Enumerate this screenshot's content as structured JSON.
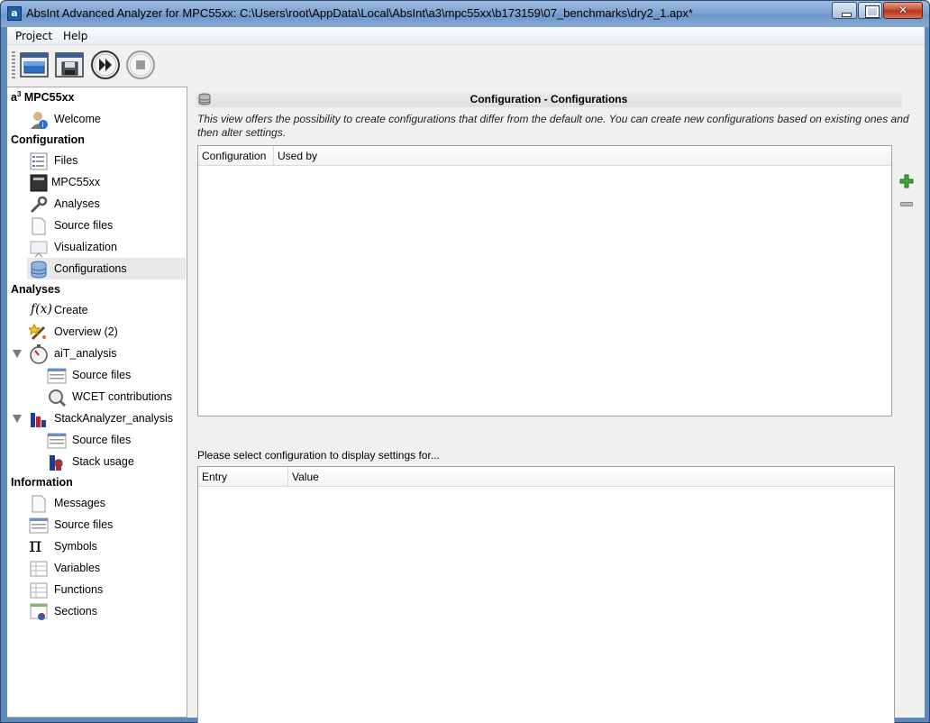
{
  "window": {
    "title": "AbsInt Advanced Analyzer for MPC55xx: C:\\Users\\root\\AppData\\Local\\AbsInt\\a3\\mpc55xx\\b173159\\07_benchmarks\\dry2_1.apx*",
    "app_icon": "a"
  },
  "menu": {
    "project": "Project",
    "help": "Help"
  },
  "toolbar": {
    "icons": [
      "open-project-icon",
      "save-project-icon",
      "run-icon",
      "stop-icon"
    ]
  },
  "sidebar": {
    "root_prefix": "a",
    "root_sup": "3",
    "root_label": "MPC55xx",
    "welcome": "Welcome",
    "configuration_header": "Configuration",
    "files": "Files",
    "mpc55xx": "MPC55xx",
    "analyses": "Analyses",
    "source_files": "Source files",
    "visualization": "Visualization",
    "configurations": "Configurations",
    "analyses_header": "Analyses",
    "create_fx": "f(x)",
    "create": "Create",
    "overview": "Overview (2)",
    "ait_analysis": "aiT_analysis",
    "ait_source_files": "Source files",
    "wcet_contributions": "WCET contributions",
    "stack_analysis": "StackAnalyzer_analysis",
    "stack_source_files": "Source files",
    "stack_usage": "Stack usage",
    "information_header": "Information",
    "messages": "Messages",
    "info_source_files": "Source files",
    "symbols": "Symbols",
    "symbols_glyph": "π",
    "variables": "Variables",
    "functions": "Functions",
    "sections": "Sections"
  },
  "main": {
    "title": "Configuration - Configurations",
    "description": "This view offers the possibility to create configurations that differ from the default one. You can create new configurations based on existing ones and then alter settings.",
    "config_table": {
      "columns": [
        "Configuration",
        "Used by"
      ],
      "rows": []
    },
    "select_message": "Please select configuration to display settings for...",
    "settings_table": {
      "columns": [
        "Entry",
        "Value"
      ],
      "rows": []
    }
  },
  "colors": {
    "titlebar": "#7ea4d2",
    "selected_row": "#e8e8e8",
    "add_green": "#3aa83a"
  }
}
